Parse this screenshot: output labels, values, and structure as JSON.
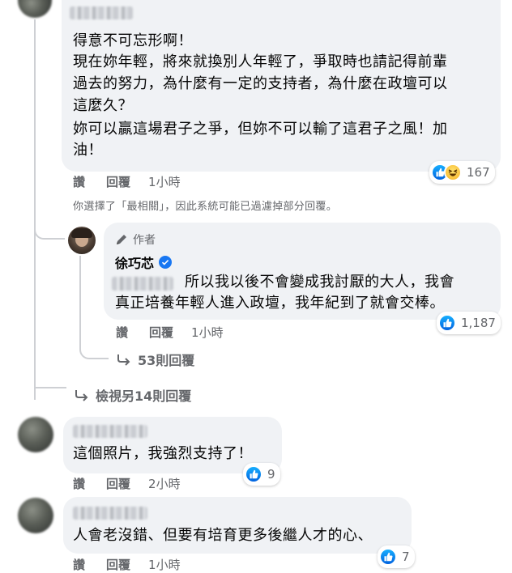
{
  "comment1": {
    "lines": [
      "得意不可忘形啊！",
      "現在妳年輕，將來就換別人年輕了，爭取時也請記得前輩",
      "過去的努力，為什麼有一定的支持者，為什麼在政壇可以",
      "這麼久？",
      "妳可以贏這場君子之爭，但妳不可以輸了這君子之風！加",
      "油！"
    ],
    "action_like": "讚",
    "action_reply": "回覆",
    "time": "1小時",
    "reaction_count": "167",
    "reaction_icons": [
      "like-icon",
      "haha-icon"
    ]
  },
  "filter_note": "你選擇了「最相關」，因此系統可能已過濾掉部分回覆。",
  "author_reply": {
    "badge": "作者",
    "name": "徐巧芯",
    "verified": true,
    "line1": "所以我以後不會變成我討厭的大人，我會",
    "line2": "真正培養年輕人進入政壇，我年紀到了就會交棒。",
    "action_like": "讚",
    "action_reply": "回覆",
    "time": "1小時",
    "reaction_count": "1,187",
    "more_replies": "53則回覆"
  },
  "view_more": "檢視另14則回覆",
  "comment2": {
    "text": "這個照片，我強烈支持了！",
    "action_like": "讚",
    "action_reply": "回覆",
    "time": "2小時",
    "reaction_count": "9"
  },
  "comment3": {
    "text": "人會老沒錯、但要有培育更多後繼人才的心、",
    "action_like": "讚",
    "action_reply": "回覆",
    "time": "1小時",
    "reaction_count": "7"
  },
  "colors": {
    "bubble": "#f0f2f5",
    "meta_text": "#65676b",
    "like_blue": "#1877f2",
    "thread_line": "#ced0d4"
  }
}
